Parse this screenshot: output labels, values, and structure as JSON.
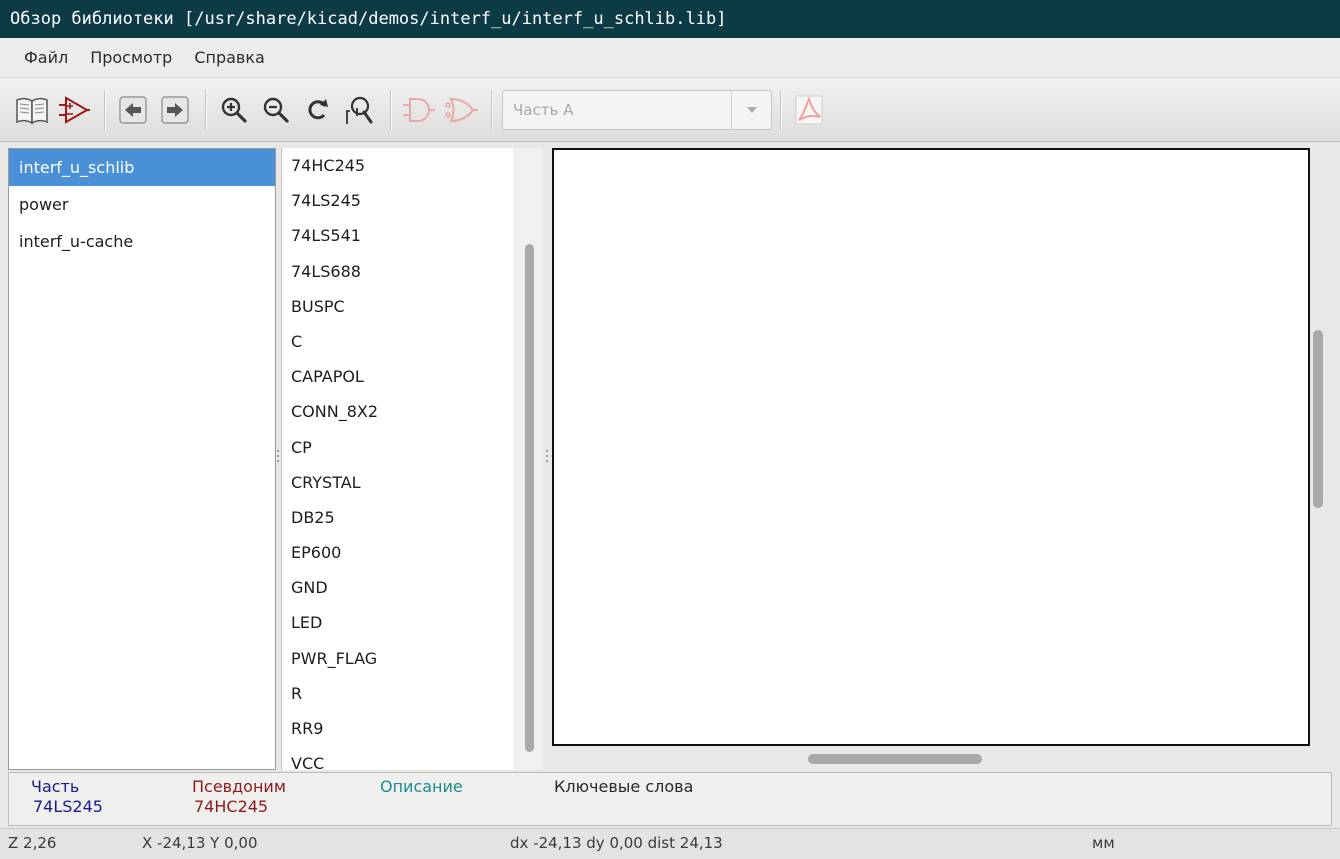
{
  "window": {
    "title": "Обзор библиотеки [/usr/share/kicad/demos/interf_u/interf_u_schlib.lib]"
  },
  "menu": [
    "Файл",
    "Просмотр",
    "Справка"
  ],
  "toolbar": {
    "icons": [
      "library-select-icon",
      "component-select-icon",
      "previous-icon",
      "next-icon",
      "zoom-in-icon",
      "zoom-out-icon",
      "zoom-redraw-icon",
      "zoom-fit-icon",
      "body-style-normal-icon",
      "body-style-demorgan-icon",
      "pdf-datasheet-icon"
    ],
    "unit_select": {
      "value": "Часть A"
    }
  },
  "libraries": {
    "items": [
      "interf_u_schlib",
      "power",
      "interf_u-cache"
    ],
    "selected_index": 0
  },
  "components": {
    "items": [
      "74HC245",
      "74LS245",
      "74LS541",
      "74LS688",
      "BUSPC",
      "C",
      "CAPAPOL",
      "CONN_8X2",
      "CP",
      "CRYSTAL",
      "DB25",
      "EP600",
      "GND",
      "LED",
      "PWR_FLAG",
      "R",
      "RR9",
      "VCC"
    ]
  },
  "info": {
    "part_label": "Часть",
    "part_value": "74LS245",
    "alias_label": "Псевдоним",
    "alias_value": "74HC245",
    "description_label": "Описание",
    "keywords_label": "Ключевые слова"
  },
  "status": {
    "zoom": "Z 2,26",
    "coords": "X -24,13  Y 0,00",
    "delta": "dx -24,13  dy 0,00  dist 24,13",
    "units": "мм"
  },
  "colors": {
    "titlebar": "#0d3b45",
    "selection": "#4a90d9",
    "part_color": "#1a1a8c",
    "alias_color": "#8c1a1a",
    "description_color": "#1a8c8c",
    "icon_red": "#a01818"
  }
}
